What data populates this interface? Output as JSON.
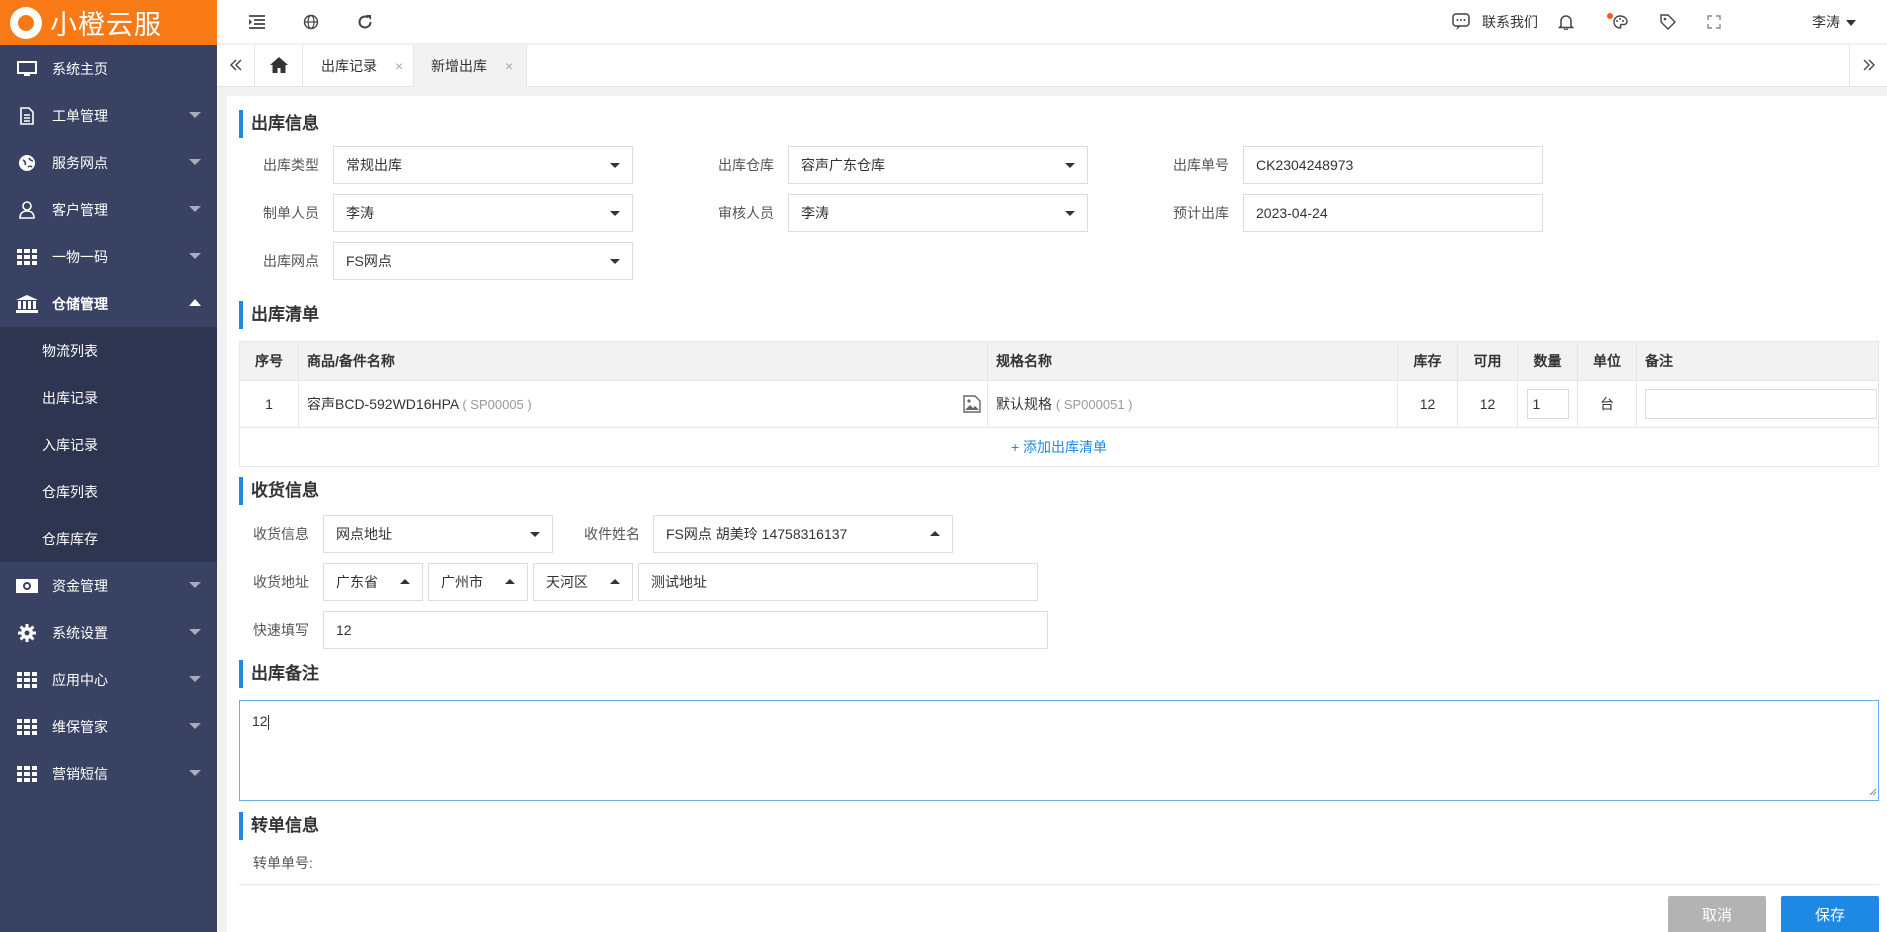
{
  "brand": {
    "name": "小橙云服",
    "color": "#f77a17"
  },
  "sidebar": {
    "items": [
      {
        "label": "系统主页",
        "icon": "monitor-icon"
      },
      {
        "label": "工单管理",
        "icon": "document-icon"
      },
      {
        "label": "服务网点",
        "icon": "globe-icon"
      },
      {
        "label": "客户管理",
        "icon": "user-icon"
      },
      {
        "label": "一物一码",
        "icon": "grid-icon"
      },
      {
        "label": "仓储管理",
        "icon": "bank-icon"
      },
      {
        "label": "资金管理",
        "icon": "money-icon"
      },
      {
        "label": "系统设置",
        "icon": "gear-icon"
      },
      {
        "label": "应用中心",
        "icon": "grid-icon"
      },
      {
        "label": "维保管家",
        "icon": "grid-icon"
      },
      {
        "label": "营销短信",
        "icon": "grid-icon"
      }
    ],
    "sub_items": [
      "物流列表",
      "出库记录",
      "入库记录",
      "仓库列表",
      "仓库库存"
    ]
  },
  "topbar": {
    "contact": "联系我们",
    "user": "李涛"
  },
  "tabs": [
    {
      "label": "出库记录",
      "close": "×"
    },
    {
      "label": "新增出库",
      "close": "×"
    }
  ],
  "outbound_info": {
    "title": "出库信息",
    "type_label": "出库类型",
    "type_value": "常规出库",
    "warehouse_label": "出库仓库",
    "warehouse_value": "容声广东仓库",
    "number_label": "出库单号",
    "number_value": "CK2304248973",
    "creator_label": "制单人员",
    "creator_value": "李涛",
    "reviewer_label": "审核人员",
    "reviewer_value": "李涛",
    "expected_label": "预计出库",
    "expected_value": "2023-04-24",
    "outlet_label": "出库网点",
    "outlet_value": "FS网点"
  },
  "outbound_list": {
    "title": "出库清单",
    "headers": [
      "序号",
      "商品/备件名称",
      "规格名称",
      "库存",
      "可用",
      "数量",
      "单位",
      "备注"
    ],
    "rows": [
      {
        "index": "1",
        "name": "容声BCD-592WD16HPA",
        "code": "( SP00005 )",
        "spec": "默认规格",
        "spec_code": "( SP000051 )",
        "stock": "12",
        "available": "12",
        "qty": "1",
        "unit": "台",
        "remark": ""
      }
    ],
    "add_label": "+ 添加出库清单"
  },
  "receive_info": {
    "title": "收货信息",
    "info_label": "收货信息",
    "info_value": "网点地址",
    "name_label": "收件姓名",
    "name_value": "FS网点 胡美玲 14758316137",
    "address_label": "收货地址",
    "province": "广东省",
    "city": "广州市",
    "district": "天河区",
    "detail": "测试地址",
    "quick_label": "快速填写",
    "quick_value": "12"
  },
  "outbound_note": {
    "title": "出库备注",
    "value": "12"
  },
  "transfer_info": {
    "title": "转单信息",
    "number_label": "转单单号:"
  },
  "actions": {
    "cancel": "取消",
    "save": "保存"
  },
  "colors": {
    "accent": "#1e88e5",
    "sidebar": "#394263",
    "cancel": "#b3b3b3",
    "save": "#1e88e5"
  }
}
